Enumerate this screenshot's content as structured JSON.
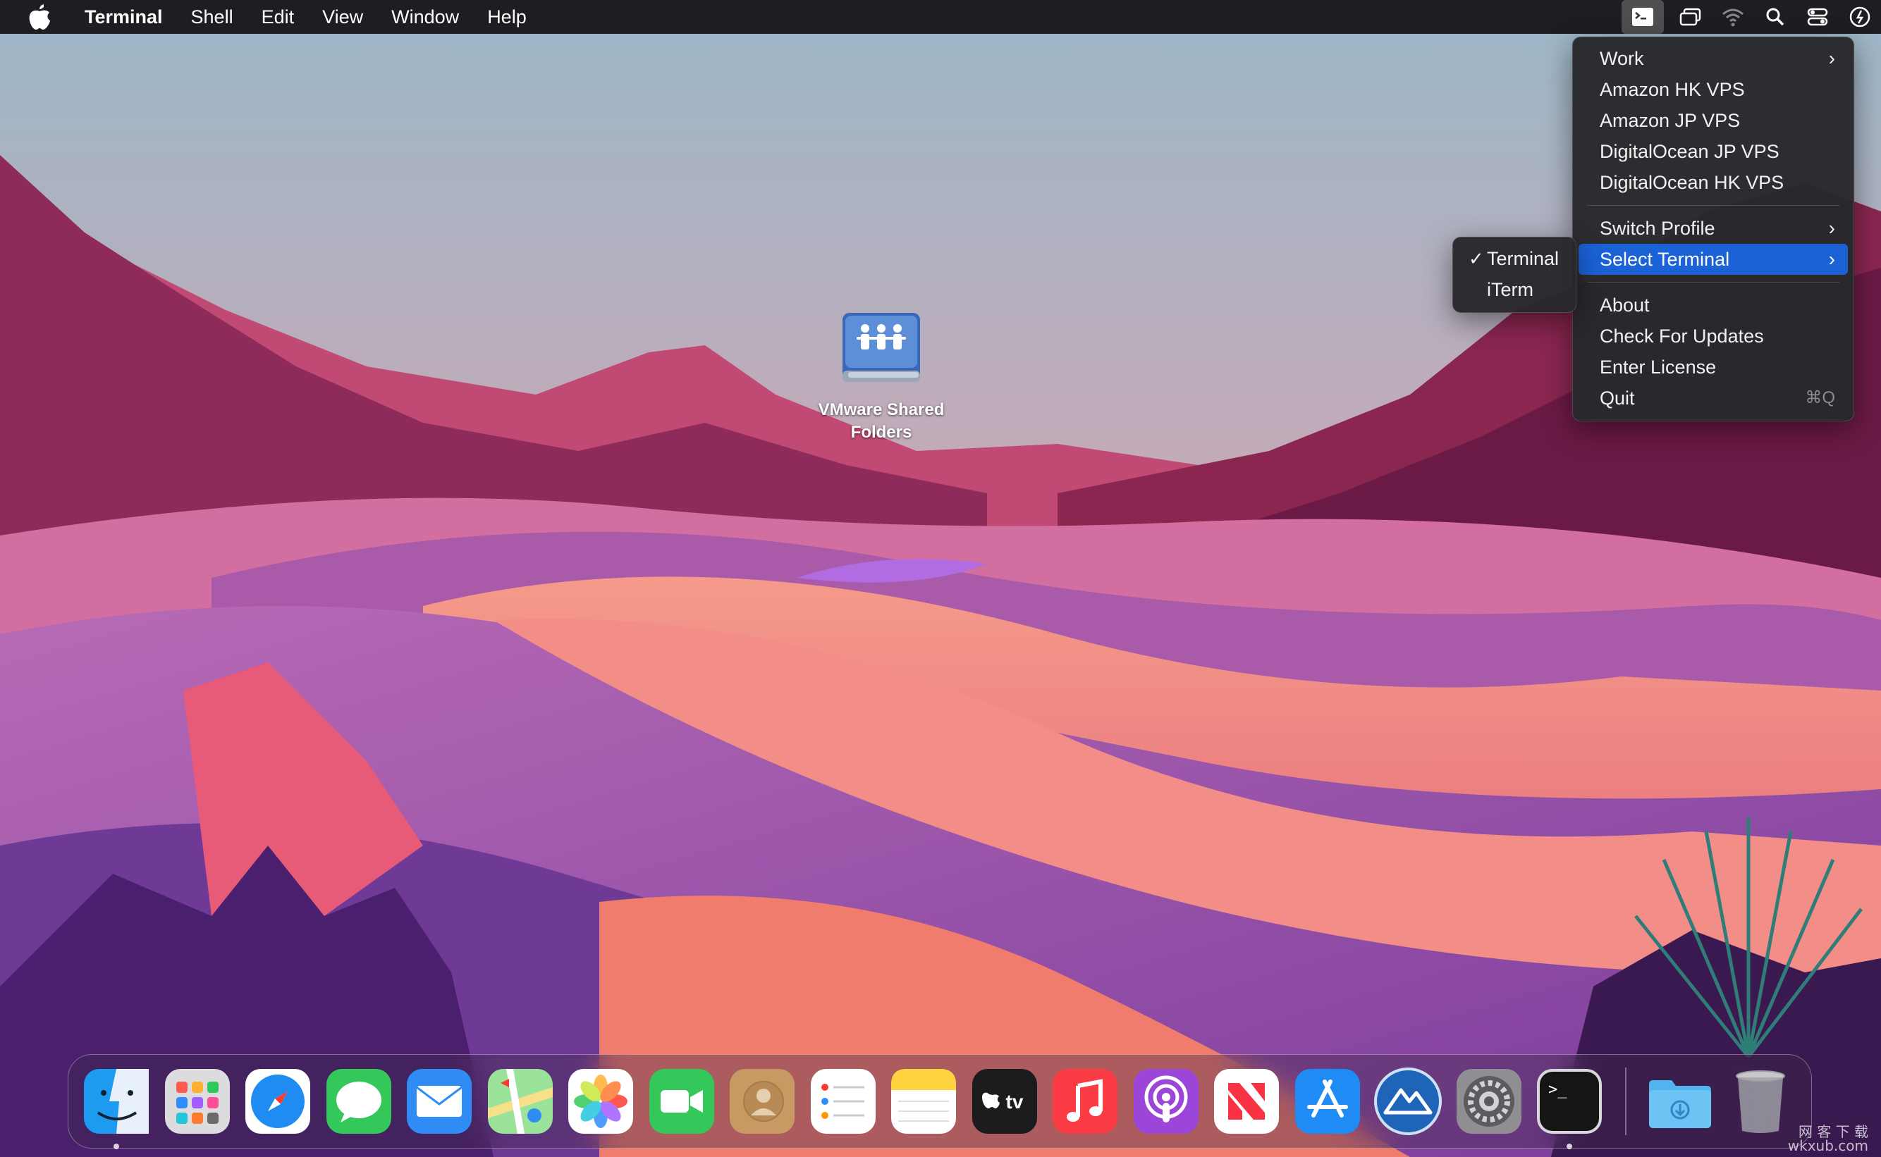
{
  "menubar": {
    "app_name": "Terminal",
    "items": [
      "Shell",
      "Edit",
      "View",
      "Window",
      "Help"
    ],
    "status_icons": [
      "terminal-status-icon",
      "screen-mirror-icon",
      "wifi-icon",
      "search-icon",
      "control-center-icon",
      "clock-icon"
    ]
  },
  "main_menu": {
    "items": [
      {
        "label": "Work",
        "submenu": true
      },
      {
        "label": "Amazon HK VPS"
      },
      {
        "label": "Amazon JP VPS"
      },
      {
        "label": "DigitalOcean JP VPS"
      },
      {
        "label": "DigitalOcean HK VPS"
      },
      {
        "label": "Switch Profile",
        "submenu": true
      },
      {
        "label": "Select Terminal",
        "submenu": true,
        "highlighted": true
      },
      {
        "label": "About"
      },
      {
        "label": "Check For Updates"
      },
      {
        "label": "Enter License"
      },
      {
        "label": "Quit",
        "shortcut": "⌘Q"
      }
    ]
  },
  "sub_menu": {
    "items": [
      {
        "label": "Terminal",
        "checked": true
      },
      {
        "label": "iTerm",
        "checked": false
      }
    ]
  },
  "desktop_icon": {
    "label_line1": "VMware Shared",
    "label_line2": "Folders"
  },
  "dock": {
    "apps": [
      "finder",
      "launchpad",
      "safari",
      "messages",
      "mail",
      "maps",
      "photos",
      "facetime",
      "contacts",
      "reminders",
      "notes",
      "tv",
      "music",
      "podcasts",
      "news",
      "app-store",
      "shuttle",
      "system-preferences",
      "terminal"
    ],
    "tv_label": "tv",
    "terminal_prompt": ">_",
    "others": [
      "downloads",
      "trash"
    ]
  },
  "watermark": {
    "line1": "网 客 下 载",
    "line2": "wkxub.com"
  },
  "colors": {
    "menu_highlight": "#1a62d6",
    "menubar": "#1e1e22"
  }
}
